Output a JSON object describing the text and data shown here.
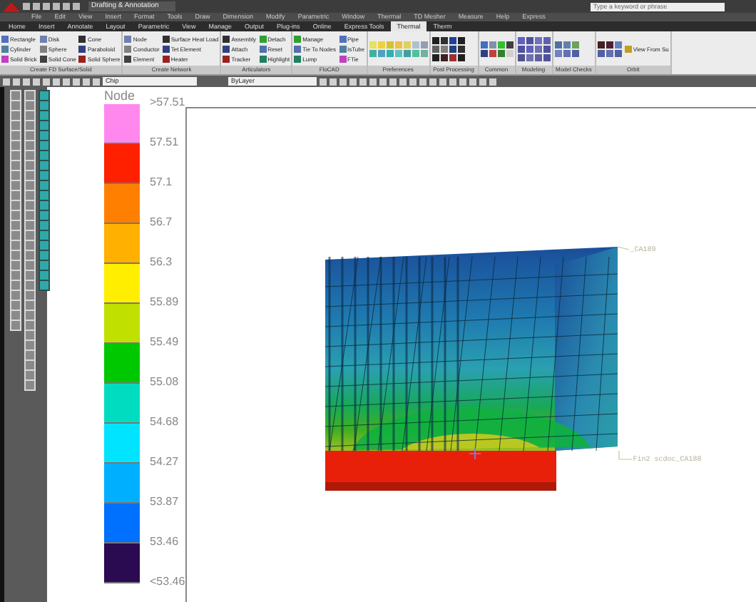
{
  "title_bar": {
    "workspace": "Drafting & Annotation",
    "search": {
      "placeholder": "Type a keyword or phrase"
    }
  },
  "menu_bar": [
    "File",
    "Edit",
    "View",
    "Insert",
    "Format",
    "Tools",
    "Draw",
    "Dimension",
    "Modify",
    "Parametric",
    "Window",
    "Thermal",
    "TD Mesher",
    "Measure",
    "Help",
    "Express"
  ],
  "tabs": [
    {
      "label": "Home",
      "selected": false
    },
    {
      "label": "Insert",
      "selected": false
    },
    {
      "label": "Annotate",
      "selected": false
    },
    {
      "label": "Layout",
      "selected": false
    },
    {
      "label": "Parametric",
      "selected": false
    },
    {
      "label": "View",
      "selected": false
    },
    {
      "label": "Manage",
      "selected": false
    },
    {
      "label": "Output",
      "selected": false
    },
    {
      "label": "Plug-ins",
      "selected": false
    },
    {
      "label": "Online",
      "selected": false
    },
    {
      "label": "Express Tools",
      "selected": false
    },
    {
      "label": "Thermal",
      "selected": true
    },
    {
      "label": "Therm",
      "selected": false
    }
  ],
  "ribbon": [
    {
      "kind": "labeled",
      "title": "Create FD Surface/Solid",
      "items": [
        "Rectangle",
        "Cylinder",
        "Solid Brick",
        "Disk",
        "Sphere",
        "Solid Cone",
        "Cone",
        "Paraboloid",
        "Solid Sphere"
      ]
    },
    {
      "kind": "labeled",
      "title": "Create Network",
      "items": [
        "Node",
        "Conductor",
        "Element",
        "Surface Heat Load",
        "Tet Element",
        "Heater"
      ]
    },
    {
      "kind": "labeled",
      "title": "Articulators",
      "items": [
        "Assembly",
        "Attach",
        "Tracker",
        "Detach",
        "Reset",
        "Highlight"
      ]
    },
    {
      "kind": "labeled",
      "title": "FloCAD",
      "items": [
        "Manage",
        "Tie To Nodes",
        "Lump",
        "Pipe",
        "IsTube",
        "FTie"
      ]
    },
    {
      "kind": "icons",
      "title": "Preferences"
    },
    {
      "kind": "icons",
      "title": "Post Processing"
    },
    {
      "kind": "icons",
      "title": "Common"
    },
    {
      "kind": "icons",
      "title": "Modeling"
    },
    {
      "kind": "icons",
      "title": "Model Checks"
    },
    {
      "kind": "icons",
      "title": "Orbit",
      "items": [
        "View From Su"
      ]
    }
  ],
  "toolbar": {
    "layer": "Chip",
    "linetype": "ByLayer"
  },
  "legend": {
    "title": "Node",
    "labels": [
      ">57.51",
      "57.51",
      "57.1",
      "56.7",
      "56.3",
      "55.89",
      "55.49",
      "55.08",
      "54.68",
      "54.27",
      "53.87",
      "53.46",
      "<53.46"
    ],
    "bands": [
      {
        "color": "#ff88ee"
      },
      {
        "color": "#ff2000"
      },
      {
        "color": "#ff8000"
      },
      {
        "color": "#ffb000"
      },
      {
        "color": "#ffee00"
      },
      {
        "color": "#c0e000"
      },
      {
        "color": "#00c800"
      },
      {
        "color": "#00dcc0"
      },
      {
        "color": "#00e4ff"
      },
      {
        "color": "#00b0ff"
      },
      {
        "color": "#0070ff"
      },
      {
        "color": "#2a0a50"
      }
    ]
  },
  "model_labels": [
    "_CA189",
    "Fin2 scdoc_CA188"
  ]
}
